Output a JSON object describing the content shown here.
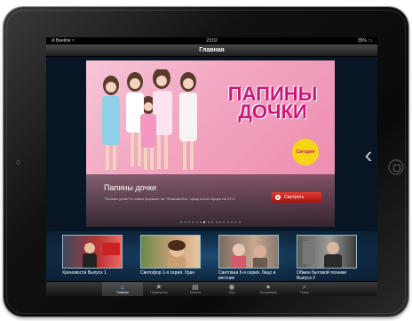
{
  "status_bar": {
    "carrier": "ıll Beeline ≈",
    "time": "23:02",
    "battery": "35% ▭"
  },
  "nav": {
    "title": "Главная"
  },
  "hero": {
    "logo_line1": "ПАПИНЫ",
    "logo_line2": "ДОЧКИ",
    "badge": "Сегодня",
    "show_title": "Папины дочки",
    "description": "\"Папины дочки\" в новом формате на \"Знакомьтесь\" сразу после эфира на СТС!",
    "watch_button": "Смотреть",
    "dots_count": 16,
    "active_dot": 6
  },
  "thumbnails": [
    {
      "caption": "Хреновости Выпуск 1"
    },
    {
      "caption": "Светофор 1-я серия. Уран"
    },
    {
      "caption": "Светлана 5-я серия. Лицо и вестник"
    },
    {
      "caption": "Обмен бытовой техники Выпуск 2"
    }
  ],
  "tabs": [
    {
      "label": "Главная",
      "icon": "home-icon",
      "glyph": "⌂"
    },
    {
      "label": "Популярное",
      "icon": "star-icon",
      "glyph": "★"
    },
    {
      "label": "Каналы",
      "icon": "clapper-icon",
      "glyph": "▤"
    },
    {
      "label": "Шоу",
      "icon": "broadcast-icon",
      "glyph": "◉"
    },
    {
      "label": "Программы",
      "icon": "chat-icon",
      "glyph": "●"
    },
    {
      "label": "Поиск",
      "icon": "search-icon",
      "glyph": "⌕"
    }
  ],
  "colors": {
    "accent_blue": "#5ab4ff",
    "watch_red": "#e23b32",
    "logo_pink": "#c8187a"
  }
}
